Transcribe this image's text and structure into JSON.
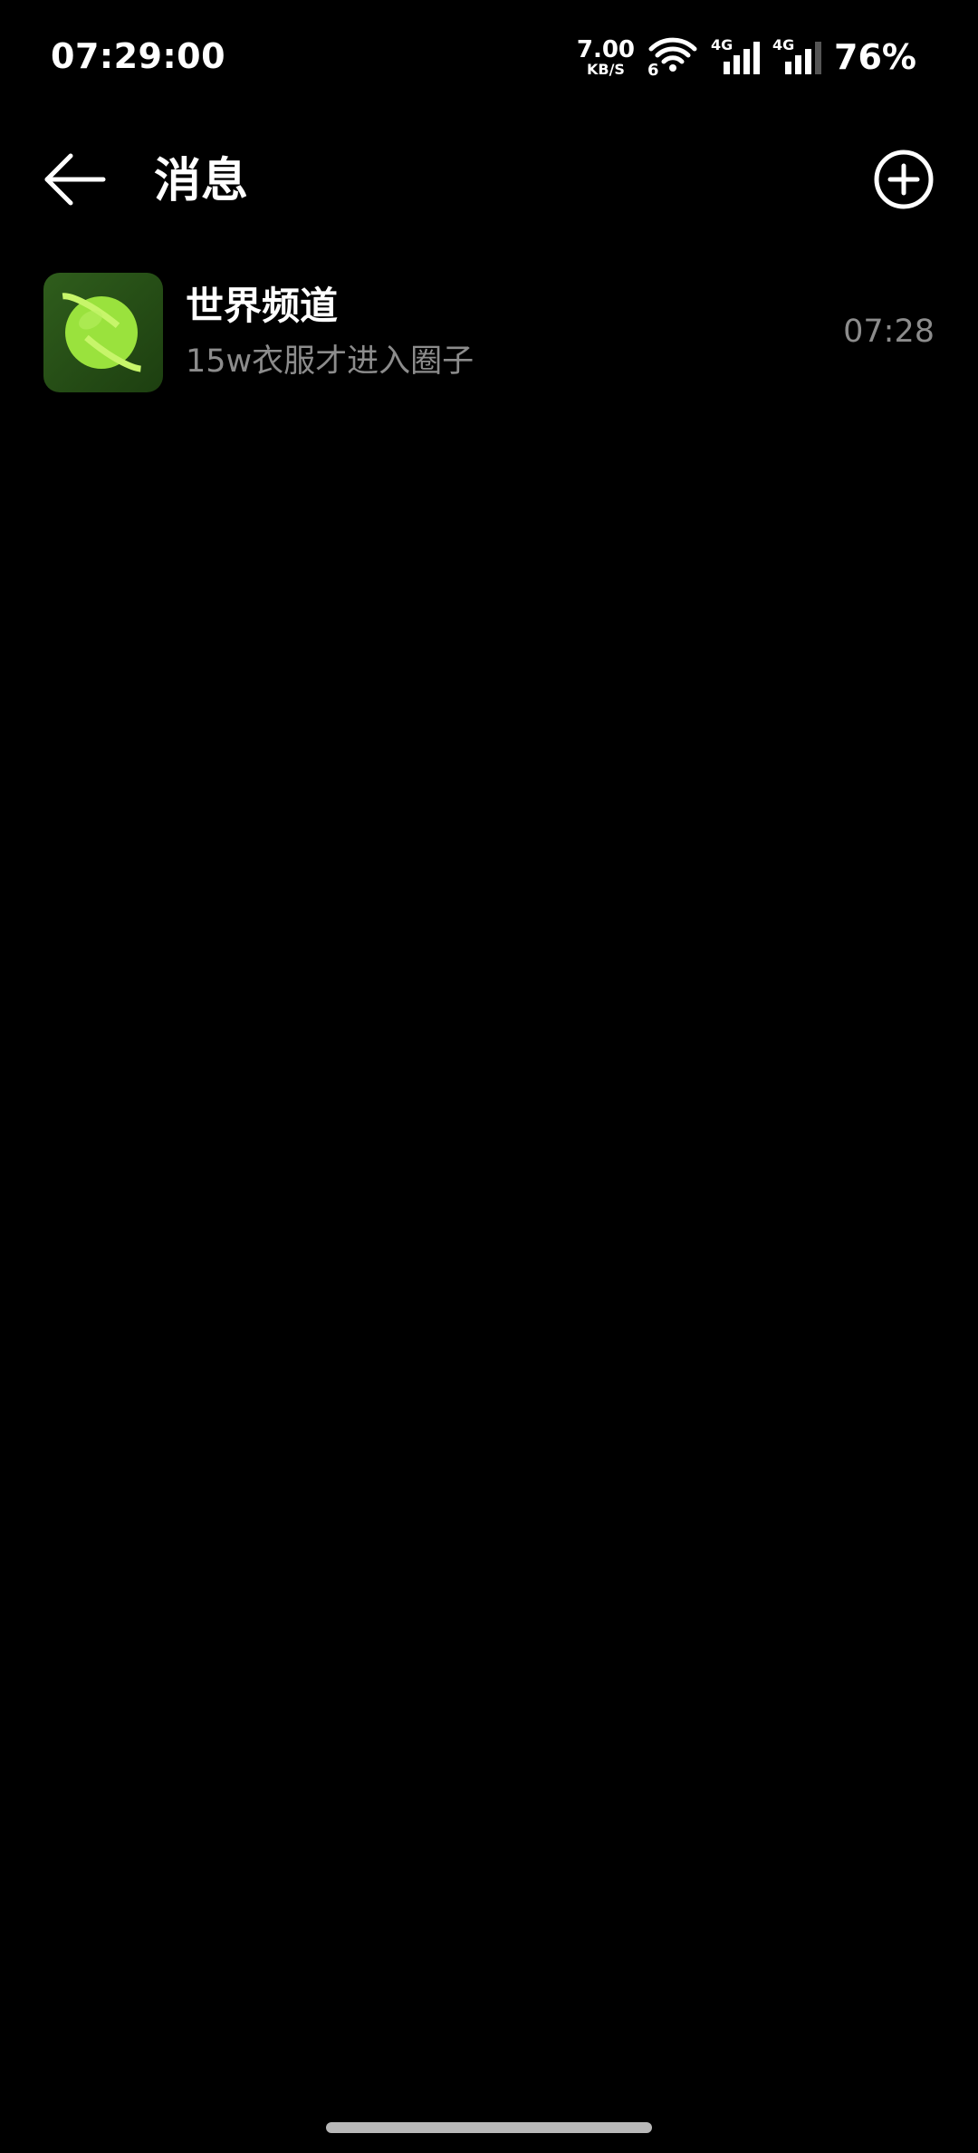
{
  "status_bar": {
    "time": "07:29:00",
    "net_speed_value": "7.00",
    "net_speed_unit": "KB/S",
    "wifi_generation": "6",
    "sim1_type": "4G",
    "sim2_type": "4G",
    "battery": "76%"
  },
  "header": {
    "title": "消息",
    "back_icon": "arrow-left-icon",
    "add_icon": "plus-circle-icon"
  },
  "conversations": [
    {
      "name": "世界频道",
      "preview": "15w衣服才进入圈子",
      "time": "07:28",
      "avatar_icon": "planet-icon",
      "avatar_colors": {
        "background": "#2a531a",
        "planet": "#9ae23d",
        "ring": "#c7f56a"
      }
    }
  ]
}
